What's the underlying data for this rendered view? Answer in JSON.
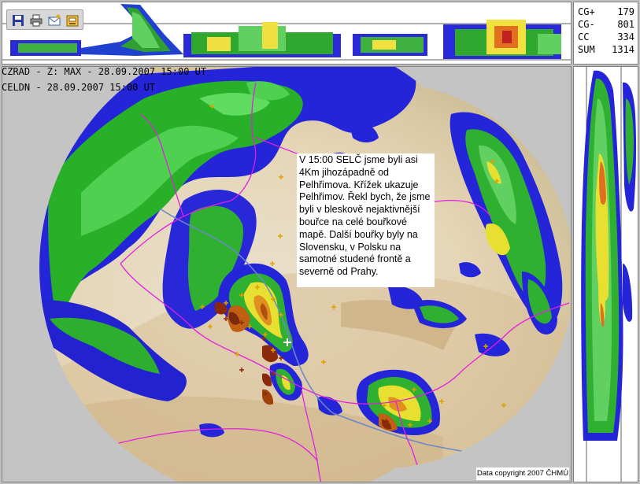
{
  "header": {
    "line1": "CZRAD - Z: MAX - 28.09.2007 15:00 UT",
    "line2": "CELDN - 28.09.2007 15:00 UT"
  },
  "stats": [
    {
      "label": "CG+",
      "value": "179"
    },
    {
      "label": "CG-",
      "value": "801"
    },
    {
      "label": "CC",
      "value": "334"
    },
    {
      "label": "SUM",
      "value": "1314"
    }
  ],
  "toolbar": {
    "icons": [
      "save-icon",
      "print-icon",
      "email-icon",
      "export-icon"
    ]
  },
  "annotation": {
    "text": "V 15:00 SELČ jsme byli asi 4Km jihozápadně od Pelhřimova. Křížek ukazuje Pelhřimov. Řekl bych, že jsme byli v bleskově nejaktivnější bouřce na celé bouřkové mapě. Další bouřky byly na Slovensku, v Polsku na samotné studené frontě a severně od Prahy."
  },
  "copyright": "Data copyright 2007 ČHMÚ",
  "colors": {
    "background": "#c0c0c0",
    "border_line": "#e020e0",
    "reflectivity_low": "#1e1edc",
    "reflectivity_mid": "#20b820",
    "reflectivity_high": "#f0e020",
    "reflectivity_max": "#8b2a0a",
    "lightning": "#e0a000"
  }
}
